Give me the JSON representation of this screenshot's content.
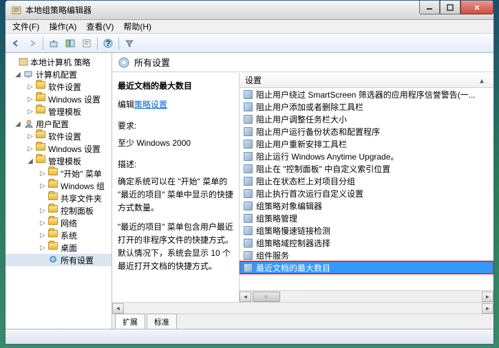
{
  "window": {
    "title": "本地组策略编辑器"
  },
  "menu": {
    "file": "文件(F)",
    "action": "操作(A)",
    "view": "查看(V)",
    "help": "帮助(H)"
  },
  "tree": {
    "root": "本地计算机 策略",
    "computer": "计算机配置",
    "c_soft": "软件设置",
    "c_win": "Windows 设置",
    "c_admin": "管理模板",
    "user": "用户配置",
    "u_soft": "软件设置",
    "u_win": "Windows 设置",
    "u_admin": "管理模板",
    "start": "\"开始\" 菜单",
    "wincomp": "Windows 组",
    "shared": "共享文件夹",
    "cpanel": "控制面板",
    "network": "网络",
    "system": "系统",
    "desktop": "桌面",
    "all": "所有设置"
  },
  "header": {
    "title": "所有设置"
  },
  "detail": {
    "title": "最近文档的最大数目",
    "edit_prefix": "编辑",
    "edit_link": "策略设置",
    "req_label": "要求:",
    "req_value": "至少 Windows 2000",
    "desc_label": "描述:",
    "desc1": "确定系统可以在 \"开始\" 菜单的 \"最近的项目\" 菜单中显示的快捷方式数量。",
    "desc2": "\"最近的项目\" 菜单包含用户最近打开的非程序文件的快捷方式。默认情况下，系统会显示 10 个最近打开文档的快捷方式。"
  },
  "list": {
    "header": "设置",
    "items": [
      "阻止用户绕过 SmartScreen 筛选器的应用程序信誉警告(一...",
      "阻止用户添加或者删除工具栏",
      "阻止用户调整任务栏大小",
      "阻止用户运行备份状态和配置程序",
      "阻止用户重新安排工具栏",
      "阻止运行 Windows Anytime Upgrade。",
      "阻止在 \"控制面板\" 中自定义索引位置",
      "阻止在状态栏上对项目分组",
      "阻止执行首次运行自定义设置",
      "组策略对象编辑器",
      "组策略管理",
      "组策略慢速链接检测",
      "组策略域控制器选择",
      "组件服务",
      "最近文档的最大数目"
    ],
    "selected_index": 14
  },
  "tabs": {
    "extended": "扩展",
    "standard": "标准"
  }
}
